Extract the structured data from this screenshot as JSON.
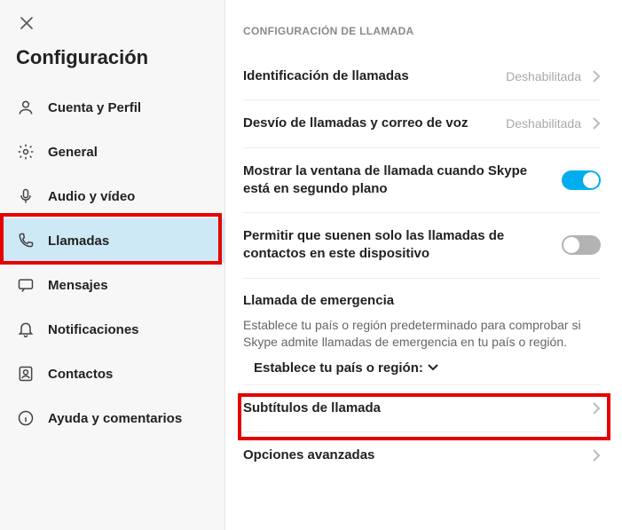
{
  "sidebar": {
    "title": "Configuración",
    "items": [
      {
        "label": "Cuenta y Perfil"
      },
      {
        "label": "General"
      },
      {
        "label": "Audio y vídeo"
      },
      {
        "label": "Llamadas"
      },
      {
        "label": "Mensajes"
      },
      {
        "label": "Notificaciones"
      },
      {
        "label": "Contactos"
      },
      {
        "label": "Ayuda y comentarios"
      }
    ]
  },
  "content": {
    "section_header": "CONFIGURACIÓN DE LLAMADA",
    "caller_id": {
      "label": "Identificación de llamadas",
      "status": "Deshabilitada"
    },
    "forwarding": {
      "label": "Desvío de llamadas y correo de voz",
      "status": "Deshabilitada"
    },
    "show_window": {
      "label": "Mostrar la ventana de llamada cuando Skype está en segundo plano",
      "on": true
    },
    "ring_contacts": {
      "label": "Permitir que suenen solo las llamadas de contactos en este dispositivo",
      "on": false
    },
    "emergency": {
      "title": "Llamada de emergencia",
      "desc": "Establece tu país o región predeterminado para comprobar si Skype admite llamadas de emergencia en tu país o región.",
      "picker": "Establece tu país o región:"
    },
    "subtitles": {
      "label": "Subtítulos de llamada"
    },
    "advanced": {
      "label": "Opciones avanzadas"
    }
  }
}
